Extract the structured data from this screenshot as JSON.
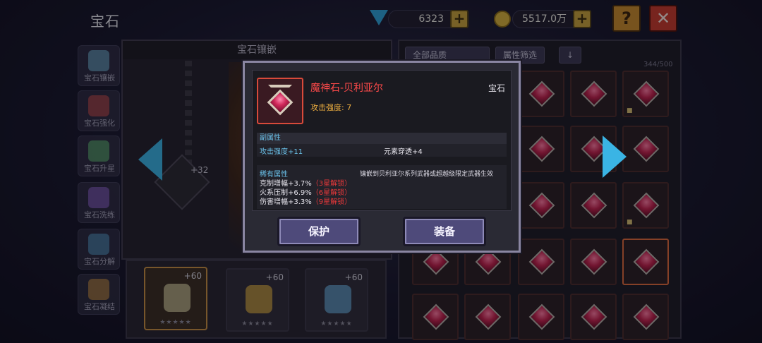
{
  "header": {
    "title": "宝石",
    "gems": "6323",
    "gold": "5517.0万",
    "help_label": "?",
    "close_label": "✕"
  },
  "sidebar": {
    "items": [
      {
        "label": "宝石镶嵌",
        "icon": "gem-inlay-icon",
        "color": "#7ac8e8"
      },
      {
        "label": "宝石强化",
        "icon": "heart-gem-icon",
        "color": "#e0504a"
      },
      {
        "label": "宝石升星",
        "icon": "star-icon",
        "color": "#6ad07a"
      },
      {
        "label": "宝石洗练",
        "icon": "purple-gem-icon",
        "color": "#9a6ae0"
      },
      {
        "label": "宝石分解",
        "icon": "hammer-icon",
        "color": "#5aa8d8"
      },
      {
        "label": "宝石凝结",
        "icon": "crystal-icon",
        "color": "#e0a040"
      }
    ]
  },
  "center": {
    "header": "宝石镶嵌",
    "slot_bonus": "+32"
  },
  "bottom_slots": [
    {
      "bonus": "+60",
      "stars": "★★★★★",
      "color": "#d8d0a0"
    },
    {
      "bonus": "+60",
      "stars": "★★★★★",
      "color": "#e0b040"
    },
    {
      "bonus": "+60",
      "stars": "★★★★★",
      "color": "#6ab0e0"
    }
  ],
  "grid": {
    "filter_all": "全部品质",
    "filter_attr": "属性筛选",
    "sort_icon": "↓",
    "count": "344/500",
    "lock_icon": "lock-icon"
  },
  "modal": {
    "item_name": "魔神石-贝利亚尔",
    "item_type": "宝石",
    "main_stat": "攻击强度: 7",
    "secondary_title": "副属性",
    "secondary_stats": [
      "攻击强度+11",
      "元素穿透+4"
    ],
    "rare_title": "稀有属性",
    "rare_desc": "镶嵌到贝利亚尔系列武器或超越级限定武器生效",
    "rare_stats": [
      {
        "text": "克制增幅+3.7%",
        "lock": "（3星解锁）"
      },
      {
        "text": "火系压制+6.9%",
        "lock": "（6星解锁）"
      },
      {
        "text": "伤害增幅+3.3%",
        "lock": "（9星解锁）"
      }
    ],
    "btn_protect": "保护",
    "btn_equip": "装备"
  }
}
